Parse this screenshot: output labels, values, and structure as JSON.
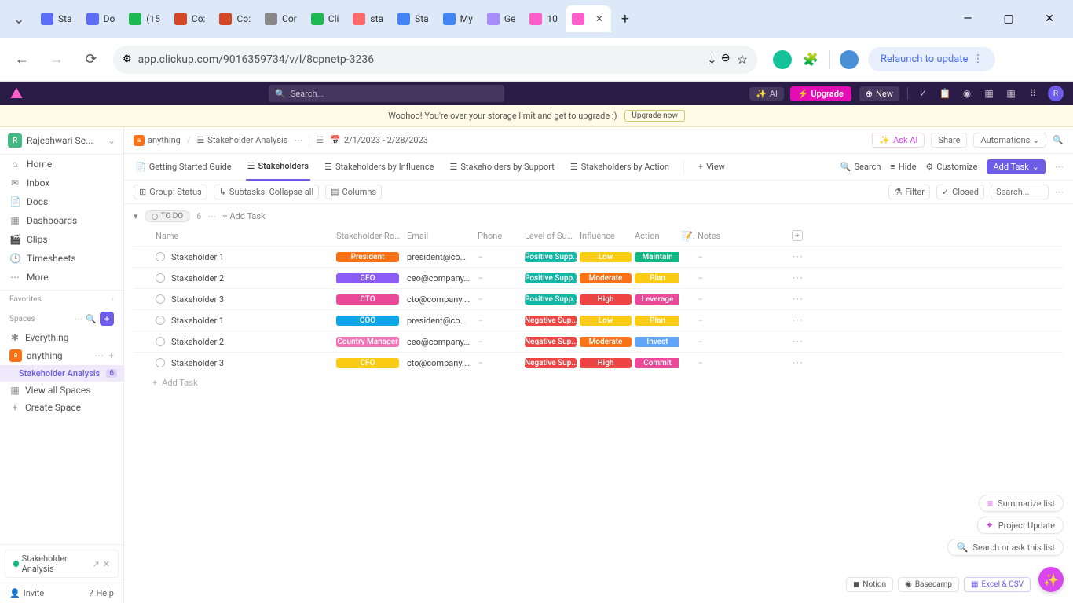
{
  "browser": {
    "tabs": [
      {
        "label": "Sta"
      },
      {
        "label": "Do"
      },
      {
        "label": "(15"
      },
      {
        "label": "Co:"
      },
      {
        "label": "Co:"
      },
      {
        "label": "Cor"
      },
      {
        "label": "Cli"
      },
      {
        "label": "sta"
      },
      {
        "label": "Sta"
      },
      {
        "label": "My"
      },
      {
        "label": "Ge"
      },
      {
        "label": "10"
      },
      {
        "label": ""
      }
    ],
    "url": "app.clickup.com/9016359734/v/l/8cpnetp-3236",
    "relaunch": "Relaunch to update"
  },
  "topbar": {
    "search_placeholder": "Search...",
    "ai": "AI",
    "upgrade": "Upgrade",
    "new": "New"
  },
  "banner": {
    "text": "Woohoo! You're over your storage limit and get to upgrade :)",
    "cta": "Upgrade now"
  },
  "sidebar": {
    "workspace": "Rajeshwari Se...",
    "nav": [
      "Home",
      "Inbox",
      "Docs",
      "Dashboards",
      "Clips",
      "Timesheets",
      "More"
    ],
    "favorites": "Favorites",
    "spaces": "Spaces",
    "everything": "Everything",
    "space_name": "anything",
    "list_name": "Stakeholder Analysis",
    "list_count": "6",
    "view_all": "View all Spaces",
    "create_space": "Create Space",
    "open_doc": "Stakeholder Analysis",
    "invite": "Invite",
    "help": "Help"
  },
  "crumbs": {
    "space": "anything",
    "list": "Stakeholder Analysis",
    "dates": "2/1/2023 - 2/28/2023",
    "askai": "Ask AI",
    "share": "Share",
    "automations": "Automations"
  },
  "views": {
    "tabs": [
      "Getting Started Guide",
      "Stakeholders",
      "Stakeholders by Influence",
      "Stakeholders by Support",
      "Stakeholders by Action"
    ],
    "active": 1,
    "add_view": "View",
    "search": "Search",
    "hide": "Hide",
    "customize": "Customize",
    "add_task": "Add Task"
  },
  "toolbar": {
    "group": "Group: Status",
    "subtasks": "Subtasks: Collapse all",
    "columns": "Columns",
    "filter": "Filter",
    "closed": "Closed",
    "search_placeholder": "Search..."
  },
  "group": {
    "status": "TO DO",
    "count": "6",
    "add_task": "Add Task"
  },
  "columns": [
    "Name",
    "Stakeholder Role",
    "Email",
    "Phone",
    "Level of Support",
    "Influence",
    "Action",
    "",
    "Notes",
    ""
  ],
  "rows": [
    {
      "name": "Stakeholder 1",
      "role": "President",
      "role_color": "#f97316",
      "email": "president@comp...",
      "phone": "–",
      "support": "Positive Supp...",
      "support_color": "#14b8a6",
      "influence": "Low",
      "influence_color": "#facc15",
      "action": "Maintain",
      "action_color": "#10b981",
      "notes": "–"
    },
    {
      "name": "Stakeholder 2",
      "role": "CEO",
      "role_color": "#8b5cf6",
      "email": "ceo@company.c...",
      "phone": "–",
      "support": "Positive Supp...",
      "support_color": "#14b8a6",
      "influence": "Moderate",
      "influence_color": "#f97316",
      "action": "Plan",
      "action_color": "#facc15",
      "notes": "–"
    },
    {
      "name": "Stakeholder 3",
      "role": "CTO",
      "role_color": "#ec4899",
      "email": "cto@company.c...",
      "phone": "–",
      "support": "Positive Supp...",
      "support_color": "#14b8a6",
      "influence": "High",
      "influence_color": "#ef4444",
      "action": "Leverage",
      "action_color": "#ec4899",
      "notes": "–"
    },
    {
      "name": "Stakeholder 1",
      "role": "COO",
      "role_color": "#0ea5e9",
      "email": "president@comp...",
      "phone": "–",
      "support": "Negative Sup...",
      "support_color": "#ef4444",
      "influence": "Low",
      "influence_color": "#facc15",
      "action": "Plan",
      "action_color": "#facc15",
      "notes": "–"
    },
    {
      "name": "Stakeholder 2",
      "role": "Country Manager",
      "role_color": "#f472b6",
      "email": "ceo@company.c...",
      "phone": "–",
      "support": "Negative Sup...",
      "support_color": "#ef4444",
      "influence": "Moderate",
      "influence_color": "#f97316",
      "action": "Invest",
      "action_color": "#60a5fa",
      "notes": "–"
    },
    {
      "name": "Stakeholder 3",
      "role": "CFO",
      "role_color": "#facc15",
      "email": "cto@company.c...",
      "phone": "–",
      "support": "Negative Sup...",
      "support_color": "#ef4444",
      "influence": "High",
      "influence_color": "#ef4444",
      "action": "Commit",
      "action_color": "#ec4899",
      "notes": "–"
    }
  ],
  "add_row": "Add Task",
  "float": {
    "summarize": "Summarize list",
    "update": "Project Update",
    "search": "Search or ask this list"
  },
  "integrations": [
    "Notion",
    "Basecamp",
    "Excel & CSV"
  ]
}
